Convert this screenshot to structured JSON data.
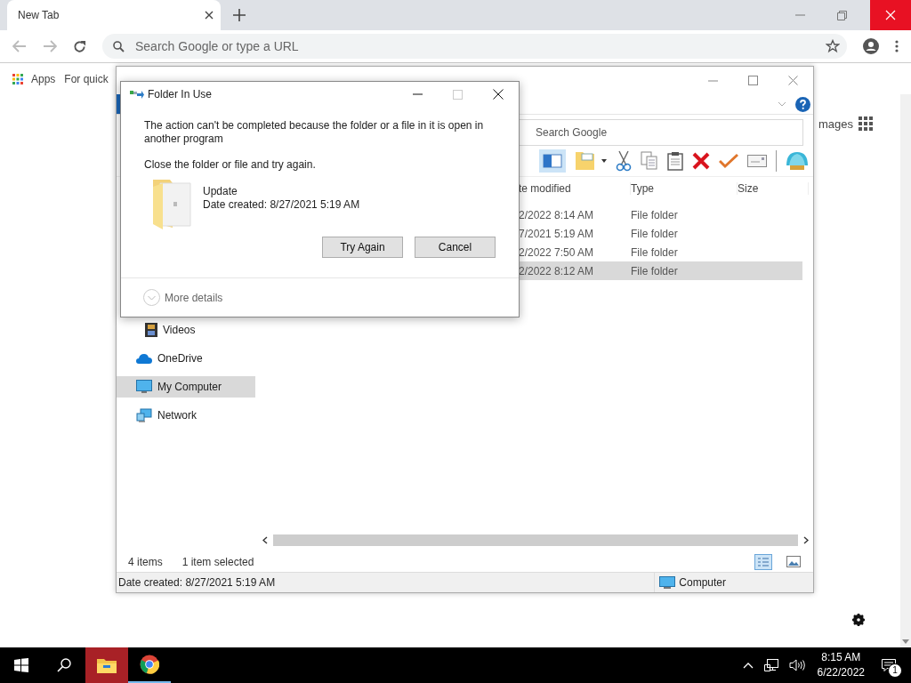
{
  "browser": {
    "tab": {
      "title": "New Tab"
    },
    "address": {
      "placeholder": "Search Google or type a URL"
    },
    "bookmarks": [
      "Apps",
      "For quick"
    ],
    "page_text": "mages"
  },
  "explorer": {
    "search": {
      "placeholder": "Search Google"
    },
    "columns": [
      "te modified",
      "Type",
      "Size"
    ],
    "rows": [
      {
        "modified": "2/2022 8:14 AM",
        "type": "File folder",
        "selected": false
      },
      {
        "modified": "7/2021 5:19 AM",
        "type": "File folder",
        "selected": false
      },
      {
        "modified": "2/2022 7:50 AM",
        "type": "File folder",
        "selected": false
      },
      {
        "modified": "2/2022 8:12 AM",
        "type": "File folder",
        "selected": true
      }
    ],
    "nav": [
      {
        "label": "Videos",
        "kind": "videos",
        "selected": false
      },
      {
        "label": "OneDrive",
        "kind": "onedrive",
        "selected": false
      },
      {
        "label": "My Computer",
        "kind": "computer",
        "selected": true
      },
      {
        "label": "Network",
        "kind": "network",
        "selected": false
      }
    ],
    "item_count": "4 items",
    "selection": "1 item selected",
    "details": "Date created: 8/27/2021 5:19 AM",
    "location": "Computer"
  },
  "dialog": {
    "title": "Folder In Use",
    "message": "The action can't be completed because the folder or a file in it is open in another program",
    "hint": "Close the folder or file and try again.",
    "file": {
      "name": "Update",
      "created": "Date created: 8/27/2021 5:19 AM"
    },
    "buttons": [
      "Try Again",
      "Cancel"
    ],
    "more_details": "More details"
  },
  "taskbar": {
    "apps": [
      {
        "kind": "explorer",
        "selected": true
      },
      {
        "kind": "chrome",
        "selected": false
      }
    ],
    "time": "8:15 AM",
    "date": "6/22/2022",
    "notifications": "1"
  }
}
